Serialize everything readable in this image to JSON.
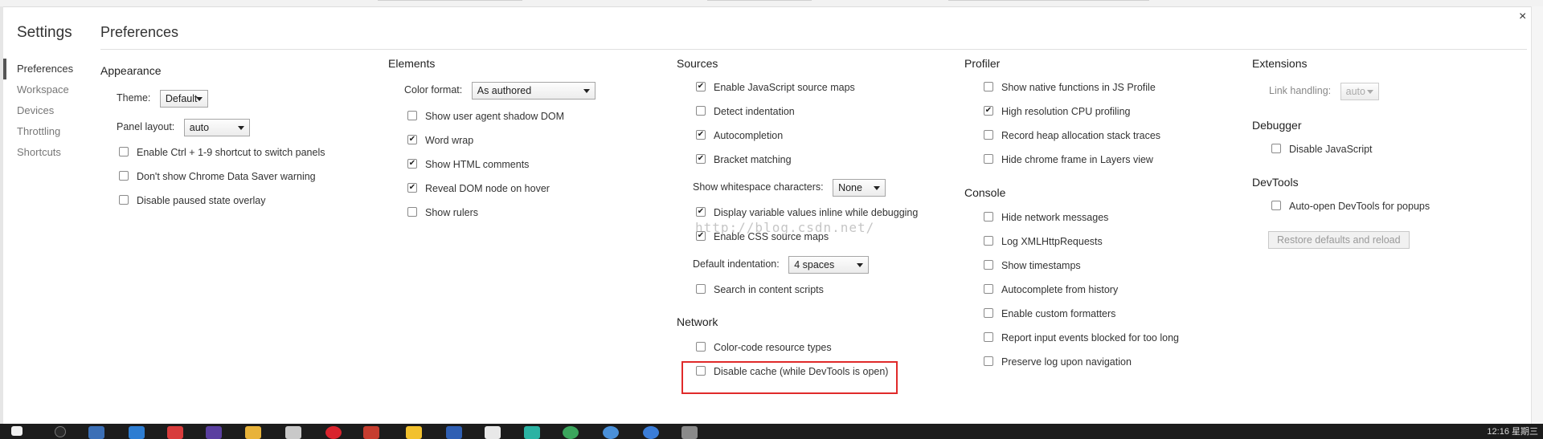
{
  "window": {
    "close_icon": "×"
  },
  "sidebar": {
    "title": "Settings",
    "items": [
      "Preferences",
      "Workspace",
      "Devices",
      "Throttling",
      "Shortcuts"
    ],
    "active": "Preferences"
  },
  "main": {
    "title": "Preferences"
  },
  "appearance": {
    "title": "Appearance",
    "theme_label": "Theme:",
    "theme_value": "Default",
    "panel_layout_label": "Panel layout:",
    "panel_layout_value": "auto",
    "options": [
      {
        "label": "Enable Ctrl + 1-9 shortcut to switch panels",
        "checked": false
      },
      {
        "label": "Don't show Chrome Data Saver warning",
        "checked": false
      },
      {
        "label": "Disable paused state overlay",
        "checked": false
      }
    ]
  },
  "elements": {
    "title": "Elements",
    "color_format_label": "Color format:",
    "color_format_value": "As authored",
    "options": [
      {
        "label": "Show user agent shadow DOM",
        "checked": false
      },
      {
        "label": "Word wrap",
        "checked": true
      },
      {
        "label": "Show HTML comments",
        "checked": true
      },
      {
        "label": "Reveal DOM node on hover",
        "checked": true
      },
      {
        "label": "Show rulers",
        "checked": false
      }
    ]
  },
  "sources": {
    "title": "Sources",
    "options_a": [
      {
        "label": "Enable JavaScript source maps",
        "checked": true
      },
      {
        "label": "Detect indentation",
        "checked": false
      },
      {
        "label": "Autocompletion",
        "checked": true
      },
      {
        "label": "Bracket matching",
        "checked": true
      }
    ],
    "whitespace_label": "Show whitespace characters:",
    "whitespace_value": "None",
    "options_b": [
      {
        "label": "Display variable values inline while debugging",
        "checked": true
      },
      {
        "label": "Enable CSS source maps",
        "checked": true
      }
    ],
    "indentation_label": "Default indentation:",
    "indentation_value": "4 spaces",
    "options_c": [
      {
        "label": "Search in content scripts",
        "checked": false
      }
    ]
  },
  "network": {
    "title": "Network",
    "options": [
      {
        "label": "Color-code resource types",
        "checked": false
      },
      {
        "label": "Disable cache (while DevTools is open)",
        "checked": false
      }
    ]
  },
  "profiler": {
    "title": "Profiler",
    "options": [
      {
        "label": "Show native functions in JS Profile",
        "checked": false
      },
      {
        "label": "High resolution CPU profiling",
        "checked": true
      },
      {
        "label": "Record heap allocation stack traces",
        "checked": false
      },
      {
        "label": "Hide chrome frame in Layers view",
        "checked": false
      }
    ]
  },
  "console": {
    "title": "Console",
    "options": [
      {
        "label": "Hide network messages",
        "checked": false
      },
      {
        "label": "Log XMLHttpRequests",
        "checked": false
      },
      {
        "label": "Show timestamps",
        "checked": false
      },
      {
        "label": "Autocomplete from history",
        "checked": false
      },
      {
        "label": "Enable custom formatters",
        "checked": false
      },
      {
        "label": "Report input events blocked for too long",
        "checked": false
      },
      {
        "label": "Preserve log upon navigation",
        "checked": false
      }
    ]
  },
  "extensions": {
    "title": "Extensions",
    "link_handling_label": "Link handling:",
    "link_handling_value": "auto"
  },
  "debugger": {
    "title": "Debugger",
    "options": [
      {
        "label": "Disable JavaScript",
        "checked": false
      }
    ]
  },
  "devtools": {
    "title": "DevTools",
    "options": [
      {
        "label": "Auto-open DevTools for popups",
        "checked": false
      }
    ],
    "restore_button": "Restore defaults and reload"
  },
  "watermark": "http://blog.csdn.net/",
  "taskbar": {
    "time": "12:16 星期三"
  },
  "colors": {
    "highlight": "#e02a2a",
    "taskbar": "#1c1c1c"
  }
}
